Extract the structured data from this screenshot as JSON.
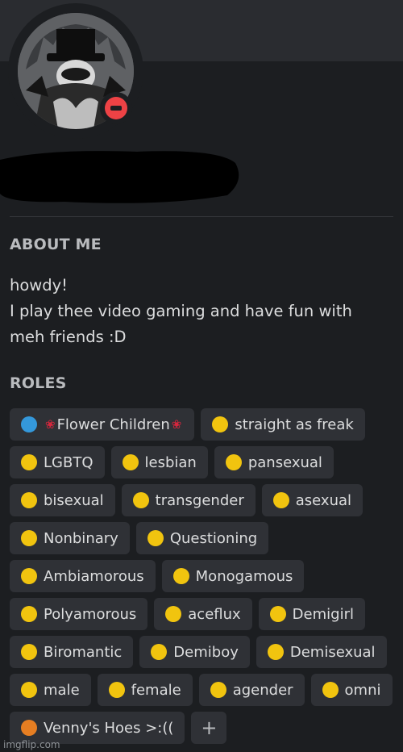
{
  "about_me": {
    "title": "ABOUT ME",
    "lines": [
      "howdy!",
      "I play thee video gaming and have fun with",
      "meh friends :D"
    ]
  },
  "roles": {
    "title": "ROLES",
    "items": [
      {
        "label": "Flower Children",
        "color": "#3498db",
        "rose": "🌹"
      },
      {
        "label": "straight as freak",
        "color": "#f1c40f"
      },
      {
        "label": "LGBTQ",
        "color": "#f1c40f"
      },
      {
        "label": "lesbian",
        "color": "#f1c40f"
      },
      {
        "label": "pansexual",
        "color": "#f1c40f"
      },
      {
        "label": "bisexual",
        "color": "#f1c40f"
      },
      {
        "label": "transgender",
        "color": "#f1c40f"
      },
      {
        "label": "asexual",
        "color": "#f1c40f"
      },
      {
        "label": "Nonbinary",
        "color": "#f1c40f"
      },
      {
        "label": "Questioning",
        "color": "#f1c40f"
      },
      {
        "label": "Ambiamorous",
        "color": "#f1c40f"
      },
      {
        "label": "Monogamous",
        "color": "#f1c40f"
      },
      {
        "label": "Polyamorous",
        "color": "#f1c40f"
      },
      {
        "label": "aceflux",
        "color": "#f1c40f"
      },
      {
        "label": "Demigirl",
        "color": "#f1c40f"
      },
      {
        "label": "Biromantic",
        "color": "#f1c40f"
      },
      {
        "label": "Demiboy",
        "color": "#f1c40f"
      },
      {
        "label": "Demisexual",
        "color": "#f1c40f"
      },
      {
        "label": "male",
        "color": "#f1c40f"
      },
      {
        "label": "female",
        "color": "#f1c40f"
      },
      {
        "label": "agender",
        "color": "#f1c40f"
      },
      {
        "label": "omni",
        "color": "#f1c40f"
      },
      {
        "label": "Venny's Hoes >:((",
        "color": "#e67e22"
      }
    ],
    "add_label": "+"
  },
  "status_color": "#ed4245",
  "watermark": "imgflip.com"
}
